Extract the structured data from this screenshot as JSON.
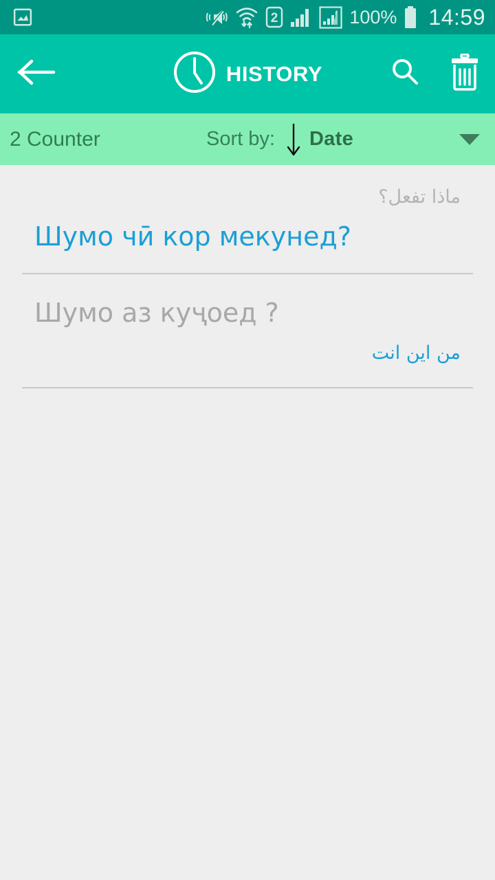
{
  "status_bar": {
    "icons": [
      {
        "name": "gallery-image-icon"
      },
      {
        "name": "vibrate-mute-icon"
      },
      {
        "name": "wifi-data-transfer-icon"
      },
      {
        "name": "sim2-icon",
        "label": "2"
      },
      {
        "name": "signal-bars-sim1-icon"
      },
      {
        "name": "signal-bars-sim2-icon"
      }
    ],
    "battery_percent": "100%",
    "battery_icon": "battery-full-icon",
    "time": "14:59",
    "background_color": "#009582"
  },
  "app_bar": {
    "back_icon": "arrow-left-icon",
    "clock_icon": "clock-icon",
    "title": "HISTORY",
    "search_icon": "search-icon",
    "delete_icon": "trash-icon",
    "background_color": "#00c4a7"
  },
  "sort_bar": {
    "counter_label": "2 Counter",
    "sort_by_label": "Sort by:",
    "sort_direction_icon": "arrow-down-icon",
    "sort_value": "Date",
    "dropdown_icon": "caret-down-icon",
    "background_color": "#85eeb5"
  },
  "history": {
    "items": [
      {
        "source_text": "ماذا تفعل؟",
        "translated_text": "Шумо чӣ кор мекунед?",
        "source_color": "#b4b4b4",
        "translated_color": "#1b9fd4"
      },
      {
        "source_text": "Шумо аз куҷоед ?",
        "translated_text": "من اين انت",
        "source_color": "#a8a8a8",
        "translated_color": "#1b9fd4"
      }
    ],
    "background_color": "#eeeeee"
  }
}
